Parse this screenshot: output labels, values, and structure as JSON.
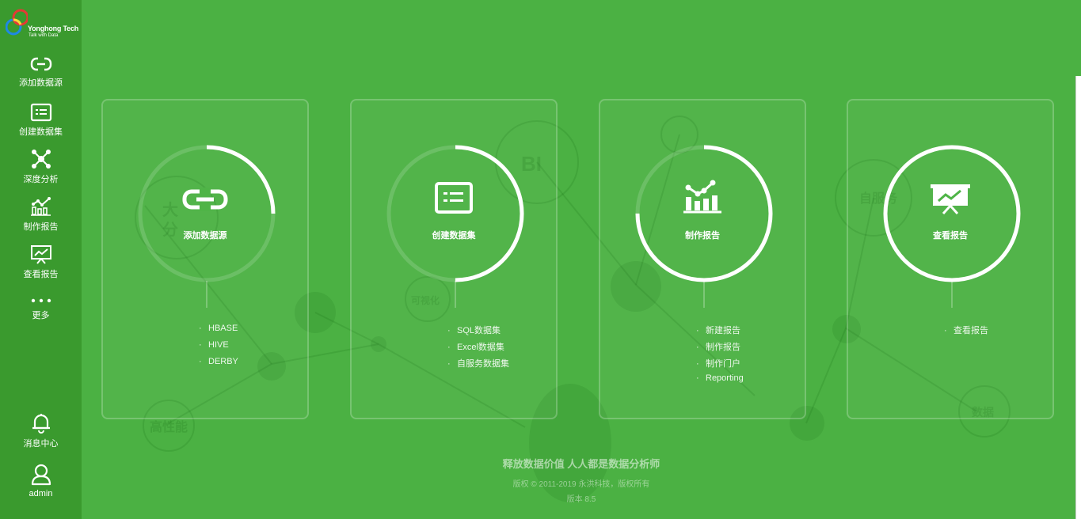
{
  "brand": {
    "name": "Yonghong Tech",
    "tagline": "Talk with Data"
  },
  "sidebar": {
    "items": [
      {
        "label": "添加数据源",
        "icon": "link-icon"
      },
      {
        "label": "创建数据集",
        "icon": "dataset-icon"
      },
      {
        "label": "深度分析",
        "icon": "network-icon"
      },
      {
        "label": "制作报告",
        "icon": "chart-icon"
      },
      {
        "label": "查看报告",
        "icon": "presentation-icon"
      },
      {
        "label": "更多",
        "icon": "more-icon"
      }
    ],
    "bottom": [
      {
        "label": "消息中心",
        "icon": "bell-icon"
      },
      {
        "label": "admin",
        "icon": "user-icon"
      }
    ]
  },
  "background": {
    "bubbles": [
      "BI",
      "大",
      "分",
      "可视化",
      "自服务",
      "高性能",
      "数据"
    ]
  },
  "cards": [
    {
      "title": "添加数据源",
      "icon": "link-icon",
      "progress": 0.25,
      "items": [
        "HBASE",
        "HIVE",
        "DERBY"
      ]
    },
    {
      "title": "创建数据集",
      "icon": "dataset-icon",
      "progress": 0.5,
      "items": [
        "SQL数据集",
        "Excel数据集",
        "自服务数据集"
      ]
    },
    {
      "title": "制作报告",
      "icon": "chart-icon",
      "progress": 0.75,
      "items": [
        "新建报告",
        "制作报告",
        "制作门户",
        "Reporting"
      ]
    },
    {
      "title": "查看报告",
      "icon": "presentation-icon",
      "progress": 1.0,
      "items": [
        "查看报告"
      ]
    }
  ],
  "footer": {
    "slogan": "释放数据价值 人人都是数据分析师",
    "copyright": "版权 © 2011-2019 永洪科技，版权所有",
    "version": "版本 8.5"
  },
  "colors": {
    "background": "#4bb143",
    "sidebar": "#3a9a2e"
  }
}
